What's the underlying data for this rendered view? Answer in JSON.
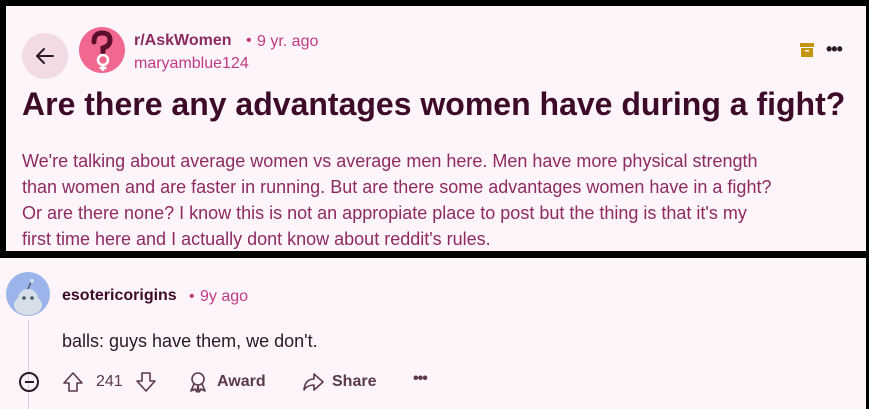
{
  "post": {
    "subreddit": "r/AskWomen",
    "separator": "•",
    "time": "9 yr. ago",
    "author": "maryamblue124",
    "title": "Are there any advantages women have during a fight?",
    "body_lines": [
      "We're talking about average women vs average men here. Men have more physical strength",
      "than women and are faster in running. But are there some advantages women have in a fight?",
      "Or are there none? I know this is not an appropiate place to post but the thing is that it's my",
      "first time here and I actually dont know about reddit's rules."
    ],
    "more_label": "•••"
  },
  "comment": {
    "username": "esotericorigins",
    "separator": "•",
    "time": "9y ago",
    "text": "balls: guys have them, we don't.",
    "votes": "241",
    "award_label": "Award",
    "share_label": "Share",
    "more_label": "•••"
  },
  "colors": {
    "background": "#fdf5f9",
    "title": "#3d0a2a",
    "body": "#8f2a63",
    "meta": "#c13a86",
    "subreddit_avatar": "#f0688f",
    "user_avatar": "#9bb4ea",
    "archive_icon": "#c2950f"
  },
  "icons": {
    "back": "arrow-left-icon",
    "archive": "archive-icon",
    "collapse": "minus-circle-icon",
    "upvote": "arrow-up-icon",
    "downvote": "arrow-down-icon",
    "award": "award-icon",
    "share": "share-icon"
  }
}
